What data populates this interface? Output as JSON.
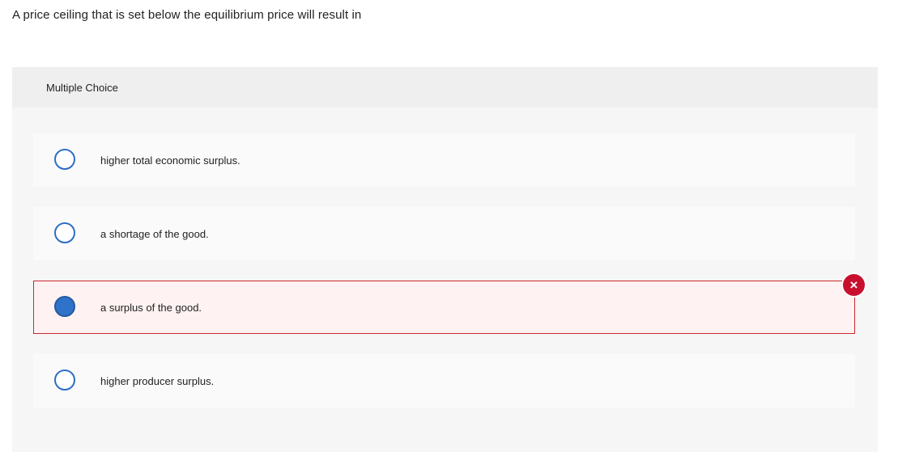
{
  "question": {
    "text": "A price ceiling that is set below the equilibrium price will result in"
  },
  "card": {
    "header_label": "Multiple Choice"
  },
  "options": [
    {
      "label": "higher total economic surplus.",
      "selected": false
    },
    {
      "label": "a shortage of the good.",
      "selected": false
    },
    {
      "label": "a surplus of the good.",
      "selected": true,
      "status": "incorrect"
    },
    {
      "label": "higher producer surplus.",
      "selected": false
    }
  ],
  "icons": {
    "incorrect_mark": "×"
  },
  "colors": {
    "radio_border": "#2f6ec5",
    "radio_selected_fill": "#2f72c9",
    "incorrect_border": "#c9292f",
    "incorrect_background": "#fff2f2",
    "incorrect_icon": "#c8102e"
  }
}
